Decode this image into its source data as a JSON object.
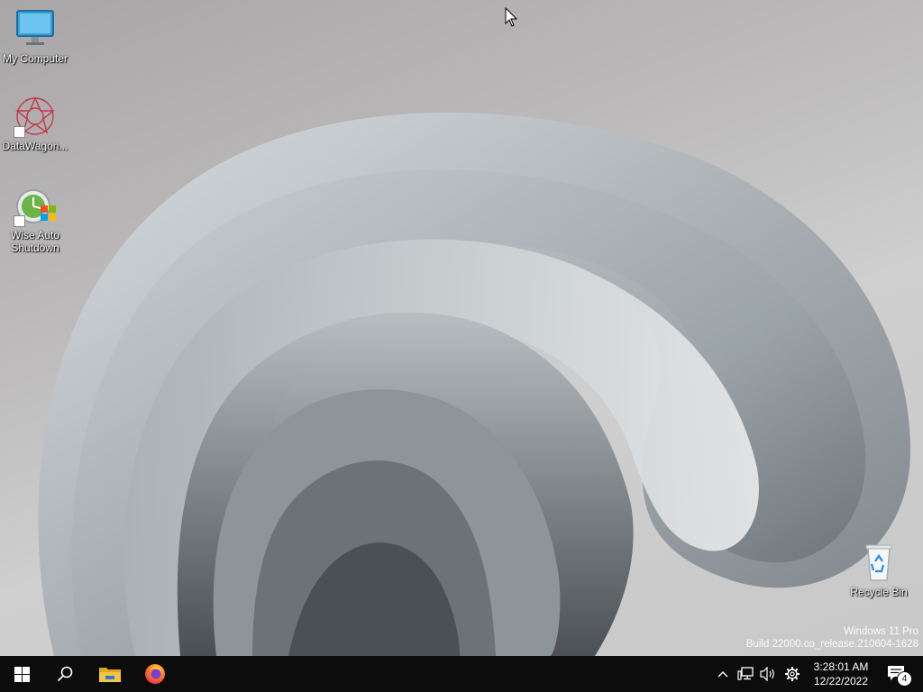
{
  "desktop": {
    "icons": [
      {
        "label": "My Computer",
        "icon": "monitor-icon"
      },
      {
        "label": "DataWagon...",
        "icon": "datawagon-flower-icon"
      },
      {
        "label_line1": "Wise Auto",
        "label_line2": "Shutdown",
        "icon": "clock-shortcut-icon"
      },
      {
        "label": "Recycle Bin",
        "icon": "recycle-bin-icon"
      }
    ],
    "watermark": {
      "line1": "Windows 11 Pro",
      "line2": "Build 22000.co_release.210604-1628"
    }
  },
  "taskbar": {
    "buttons": [
      "windows-start-icon",
      "search-icon",
      "file-explorer-icon",
      "firefox-icon"
    ],
    "tray": {
      "icons": [
        "chevron-up-icon",
        "network-icon",
        "volume-icon",
        "gear-icon"
      ],
      "time": "3:28:01 AM",
      "date": "12/22/2022",
      "notification_count": "4"
    }
  },
  "colors": {
    "taskbar": "#0c0c0c",
    "start": "#ffffff",
    "folder": "#f4c542"
  }
}
